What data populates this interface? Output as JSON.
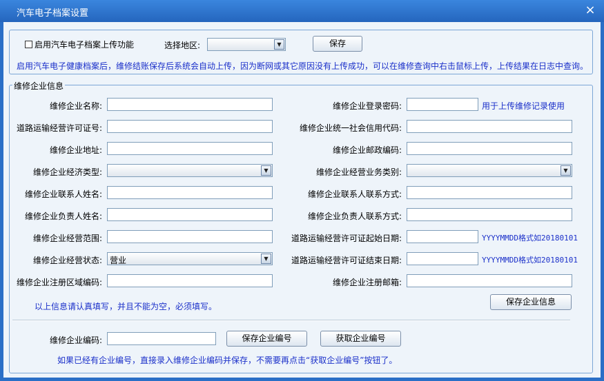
{
  "window": {
    "title": "汽车电子档案设置",
    "close_glyph": "×"
  },
  "upload": {
    "enable_label": "启用汽车电子档案上传功能",
    "region_label": "选择地区:",
    "region_value": "",
    "save_label": "保存",
    "note": "启用汽车电子健康档案后，维修结账保存后系统会自动上传，因为断网或其它原因没有上传成功，可以在维修查询中右击鼠标上传，上传结果在日志中查询。"
  },
  "company": {
    "legend": "维修企业信息",
    "left": [
      {
        "label": "维修企业名称:",
        "type": "input",
        "value": ""
      },
      {
        "label": "道路运输经营许可证号:",
        "type": "input",
        "value": ""
      },
      {
        "label": "维修企业地址:",
        "type": "input",
        "value": ""
      },
      {
        "label": "维修企业经济类型:",
        "type": "select",
        "value": ""
      },
      {
        "label": "维修企业联系人姓名:",
        "type": "input",
        "value": ""
      },
      {
        "label": "维修企业负责人姓名:",
        "type": "input",
        "value": ""
      },
      {
        "label": "维修企业经营范围:",
        "type": "input",
        "value": ""
      },
      {
        "label": "维修企业经营状态:",
        "type": "select",
        "value": "营业"
      },
      {
        "label": "维修企业注册区域编码:",
        "type": "input",
        "value": ""
      }
    ],
    "right": [
      {
        "label": "维修企业登录密码:",
        "type": "input",
        "value": "",
        "hint": "用于上传维修记录使用"
      },
      {
        "label": "维修企业统一社会信用代码:",
        "type": "input",
        "value": ""
      },
      {
        "label": "维修企业邮政编码:",
        "type": "input",
        "value": ""
      },
      {
        "label": "维修企业经营业务类别:",
        "type": "select",
        "value": ""
      },
      {
        "label": "维修企业联系人联系方式:",
        "type": "input",
        "value": ""
      },
      {
        "label": "维修企业负责人联系方式:",
        "type": "input",
        "value": ""
      },
      {
        "label": "道路运输经营许可证起始日期:",
        "type": "input",
        "value": "",
        "hint": "YYYYMMDD格式如20180101"
      },
      {
        "label": "道路运输经营许可证结束日期:",
        "type": "input",
        "value": "",
        "hint": "YYYYMMDD格式如20180101"
      },
      {
        "label": "维修企业注册邮箱:",
        "type": "input",
        "value": ""
      }
    ],
    "required_note": "以上信息请认真填写，并且不能为空，必须填写。",
    "save_info_label": "保存企业信息",
    "code_label": "维修企业编码:",
    "code_value": "",
    "save_code_label": "保存企业编号",
    "get_code_label": "获取企业编号",
    "code_note": "如果已经有企业编号，直接录入维修企业编码并保存，不需要再点击“获取企业编号”按钮了。"
  },
  "colors": {
    "title_bar": "#2a6fc7",
    "background": "#eef4fa",
    "hint_text": "#1a2fc9"
  }
}
